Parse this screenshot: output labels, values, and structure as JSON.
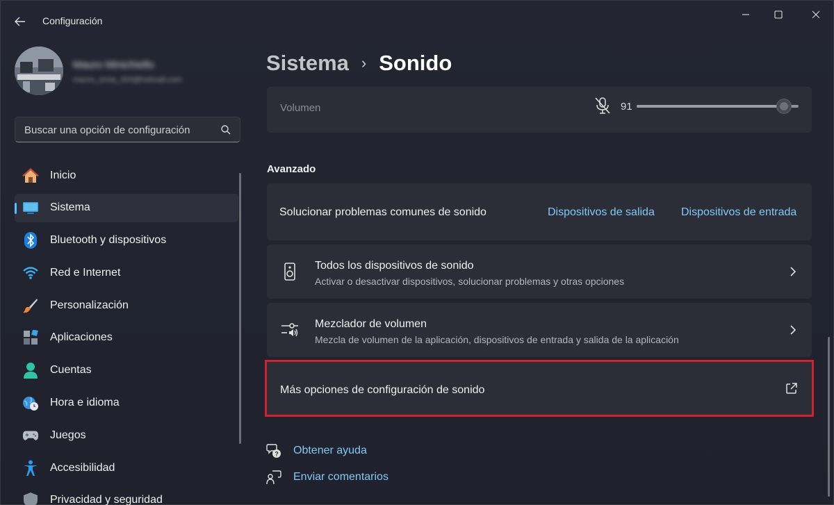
{
  "window": {
    "title": "Configuración"
  },
  "profile": {
    "name": "Mauro Minichiello",
    "email": "mauro_ornia_303@hotmail.com"
  },
  "search": {
    "placeholder": "Buscar una opción de configuración"
  },
  "sidebar": {
    "items": [
      {
        "label": "Inicio",
        "icon": "home-icon"
      },
      {
        "label": "Sistema",
        "icon": "system-icon",
        "active": true
      },
      {
        "label": "Bluetooth y dispositivos",
        "icon": "bluetooth-icon"
      },
      {
        "label": "Red e Internet",
        "icon": "wifi-icon"
      },
      {
        "label": "Personalización",
        "icon": "brush-icon"
      },
      {
        "label": "Aplicaciones",
        "icon": "apps-icon"
      },
      {
        "label": "Cuentas",
        "icon": "account-icon"
      },
      {
        "label": "Hora e idioma",
        "icon": "clock-globe-icon"
      },
      {
        "label": "Juegos",
        "icon": "gamepad-icon"
      },
      {
        "label": "Accesibilidad",
        "icon": "accessibility-icon"
      },
      {
        "label": "Privacidad y seguridad",
        "icon": "shield-icon"
      }
    ]
  },
  "breadcrumb": {
    "parent": "Sistema",
    "separator": "›",
    "current": "Sonido"
  },
  "volume": {
    "label": "Volumen",
    "value": "91",
    "level": 0.91
  },
  "advanced": {
    "heading": "Avanzado",
    "troubleshoot": {
      "label": "Solucionar problemas comunes de sonido",
      "link_output": "Dispositivos de salida",
      "link_input": "Dispositivos de entrada"
    },
    "all_devices": {
      "title": "Todos los dispositivos de sonido",
      "subtitle": "Activar o desactivar dispositivos, solucionar problemas y otras opciones"
    },
    "mixer": {
      "title": "Mezclador de volumen",
      "subtitle": "Mezcla de volumen de la aplicación, dispositivos de entrada y salida de la aplicación"
    },
    "more_options": {
      "label": "Más opciones de configuración de sonido"
    }
  },
  "help": {
    "get_help": "Obtener ayuda",
    "feedback": "Enviar comentarios"
  },
  "colors": {
    "accent": "#4cc2ff",
    "link": "#7fc9f3",
    "highlight_border": "#d3212d"
  }
}
